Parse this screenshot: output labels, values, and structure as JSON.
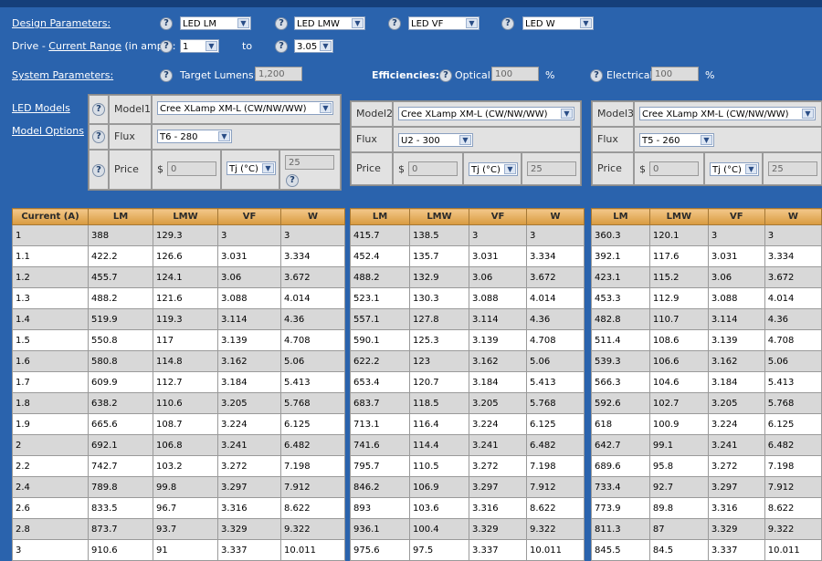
{
  "design": {
    "label": "Design Parameters:",
    "selects": [
      "LED LM",
      "LED LMW",
      "LED VF",
      "LED W"
    ]
  },
  "drive": {
    "prefix": "Drive - ",
    "link": "Current Range",
    "suffix": " (in amps):",
    "from": "1",
    "to_label": "to",
    "to": "3.05"
  },
  "system": {
    "label": "System Parameters:",
    "target_lumens_label": "Target Lumens:",
    "target_lumens": "1,200",
    "efficiencies_label": "Efficiencies:",
    "optical_label": "Optical:",
    "optical": "100",
    "electrical_label": "Electrical:",
    "electrical": "100",
    "percent": "%"
  },
  "side_links": {
    "led_models": "LED Models",
    "model_options": "Model Options"
  },
  "labels": {
    "flux": "Flux",
    "price": "Price",
    "currency": "$",
    "temp_unit": "Tj (°C)"
  },
  "icons": {
    "help": "question-help-icon",
    "dropdown": "chevron-down-icon"
  },
  "models": [
    {
      "name": "Model1",
      "led": "Cree XLamp XM-L (CW/NW/WW)",
      "flux": "T6 - 280",
      "price": "0",
      "temp": "25"
    },
    {
      "name": "Model2",
      "led": "Cree XLamp XM-L (CW/NW/WW)",
      "flux": "U2 - 300",
      "price": "0",
      "temp": "25"
    },
    {
      "name": "Model3",
      "led": "Cree XLamp XM-L (CW/NW/WW)",
      "flux": "T5 - 260",
      "price": "0",
      "temp": "25"
    }
  ],
  "table": {
    "current_header": "Current (A)",
    "headers": [
      "LM",
      "LMW",
      "VF",
      "W"
    ],
    "currents": [
      "1",
      "1.1",
      "1.2",
      "1.3",
      "1.4",
      "1.5",
      "1.6",
      "1.7",
      "1.8",
      "1.9",
      "2",
      "2.2",
      "2.4",
      "2.6",
      "2.8",
      "3"
    ],
    "models": [
      [
        [
          "388",
          "129.3",
          "3",
          "3"
        ],
        [
          "422.2",
          "126.6",
          "3.031",
          "3.334"
        ],
        [
          "455.7",
          "124.1",
          "3.06",
          "3.672"
        ],
        [
          "488.2",
          "121.6",
          "3.088",
          "4.014"
        ],
        [
          "519.9",
          "119.3",
          "3.114",
          "4.36"
        ],
        [
          "550.8",
          "117",
          "3.139",
          "4.708"
        ],
        [
          "580.8",
          "114.8",
          "3.162",
          "5.06"
        ],
        [
          "609.9",
          "112.7",
          "3.184",
          "5.413"
        ],
        [
          "638.2",
          "110.6",
          "3.205",
          "5.768"
        ],
        [
          "665.6",
          "108.7",
          "3.224",
          "6.125"
        ],
        [
          "692.1",
          "106.8",
          "3.241",
          "6.482"
        ],
        [
          "742.7",
          "103.2",
          "3.272",
          "7.198"
        ],
        [
          "789.8",
          "99.8",
          "3.297",
          "7.912"
        ],
        [
          "833.5",
          "96.7",
          "3.316",
          "8.622"
        ],
        [
          "873.7",
          "93.7",
          "3.329",
          "9.322"
        ],
        [
          "910.6",
          "91",
          "3.337",
          "10.011"
        ]
      ],
      [
        [
          "415.7",
          "138.5",
          "3",
          "3"
        ],
        [
          "452.4",
          "135.7",
          "3.031",
          "3.334"
        ],
        [
          "488.2",
          "132.9",
          "3.06",
          "3.672"
        ],
        [
          "523.1",
          "130.3",
          "3.088",
          "4.014"
        ],
        [
          "557.1",
          "127.8",
          "3.114",
          "4.36"
        ],
        [
          "590.1",
          "125.3",
          "3.139",
          "4.708"
        ],
        [
          "622.2",
          "123",
          "3.162",
          "5.06"
        ],
        [
          "653.4",
          "120.7",
          "3.184",
          "5.413"
        ],
        [
          "683.7",
          "118.5",
          "3.205",
          "5.768"
        ],
        [
          "713.1",
          "116.4",
          "3.224",
          "6.125"
        ],
        [
          "741.6",
          "114.4",
          "3.241",
          "6.482"
        ],
        [
          "795.7",
          "110.5",
          "3.272",
          "7.198"
        ],
        [
          "846.2",
          "106.9",
          "3.297",
          "7.912"
        ],
        [
          "893",
          "103.6",
          "3.316",
          "8.622"
        ],
        [
          "936.1",
          "100.4",
          "3.329",
          "9.322"
        ],
        [
          "975.6",
          "97.5",
          "3.337",
          "10.011"
        ]
      ],
      [
        [
          "360.3",
          "120.1",
          "3",
          "3"
        ],
        [
          "392.1",
          "117.6",
          "3.031",
          "3.334"
        ],
        [
          "423.1",
          "115.2",
          "3.06",
          "3.672"
        ],
        [
          "453.3",
          "112.9",
          "3.088",
          "4.014"
        ],
        [
          "482.8",
          "110.7",
          "3.114",
          "4.36"
        ],
        [
          "511.4",
          "108.6",
          "3.139",
          "4.708"
        ],
        [
          "539.3",
          "106.6",
          "3.162",
          "5.06"
        ],
        [
          "566.3",
          "104.6",
          "3.184",
          "5.413"
        ],
        [
          "592.6",
          "102.7",
          "3.205",
          "5.768"
        ],
        [
          "618",
          "100.9",
          "3.224",
          "6.125"
        ],
        [
          "642.7",
          "99.1",
          "3.241",
          "6.482"
        ],
        [
          "689.6",
          "95.8",
          "3.272",
          "7.198"
        ],
        [
          "733.4",
          "92.7",
          "3.297",
          "7.912"
        ],
        [
          "773.9",
          "89.8",
          "3.316",
          "8.622"
        ],
        [
          "811.3",
          "87",
          "3.329",
          "9.322"
        ],
        [
          "845.5",
          "84.5",
          "3.337",
          "10.011"
        ]
      ]
    ]
  }
}
